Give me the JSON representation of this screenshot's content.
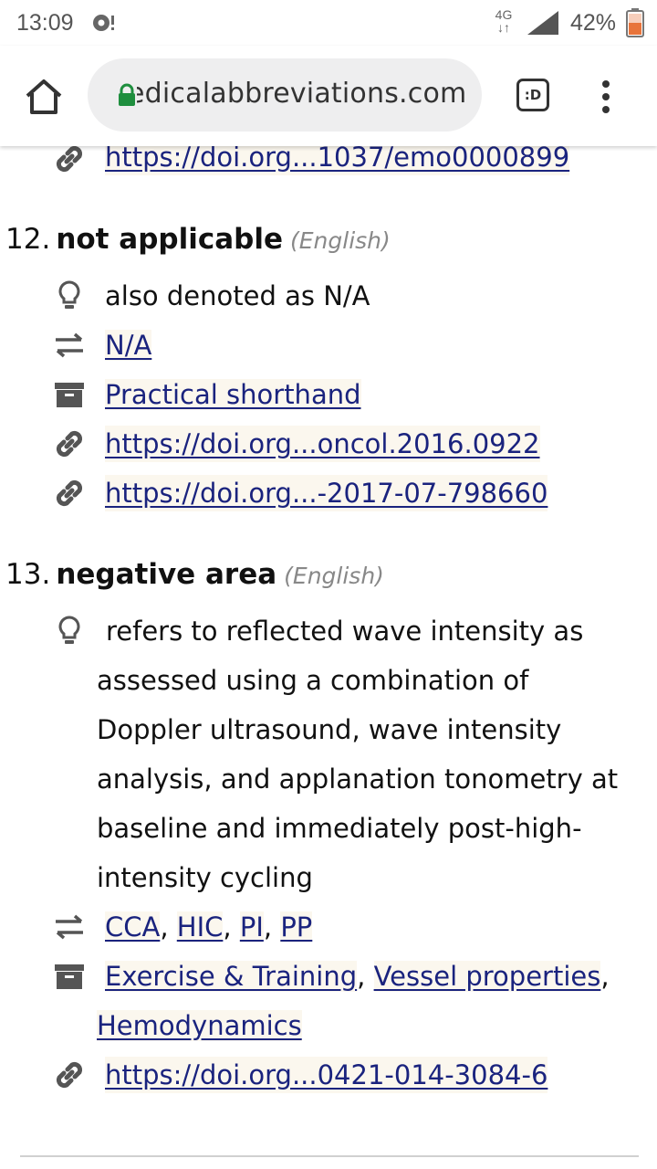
{
  "status_bar": {
    "time": "13:09",
    "network": "4G",
    "battery": "42%",
    "icons": [
      "notification-icon",
      "signal-icon",
      "battery-icon"
    ]
  },
  "browser": {
    "url": "edicalabbreviations.com",
    "tabs_label": ":D",
    "accent_lock": "#1e8e3e"
  },
  "entries": [
    {
      "top_link": "https://doi.org...1037/emo0000899"
    },
    {
      "number": "12.",
      "term": "not applicable",
      "language": "(English)",
      "description": "also denoted as N/A",
      "synonyms": [
        "N/A"
      ],
      "categories": [
        "Practical shorthand"
      ],
      "links": [
        "https://doi.org...oncol.2016.0922",
        "https://doi.org...-2017-07-798660"
      ]
    },
    {
      "number": "13.",
      "term": "negative area",
      "language": "(English)",
      "description_lines": [
        "refers to reflected wave intensity as",
        "assessed using a combination of",
        "Doppler ultrasound, wave intensity",
        "analysis, and applanation tonometry at",
        "baseline and immediately post-high-",
        "intensity cycling"
      ],
      "synonyms": [
        "CCA",
        "HIC",
        "PI",
        "PP"
      ],
      "categories": [
        "Exercise & Training",
        "Vessel properties",
        "Hemodynamics"
      ],
      "links": [
        "https://doi.org...0421-014-3084-6"
      ]
    }
  ],
  "colors": {
    "link": "#1a237e",
    "link_bg": "#fbf7ee",
    "icon": "#555555"
  }
}
